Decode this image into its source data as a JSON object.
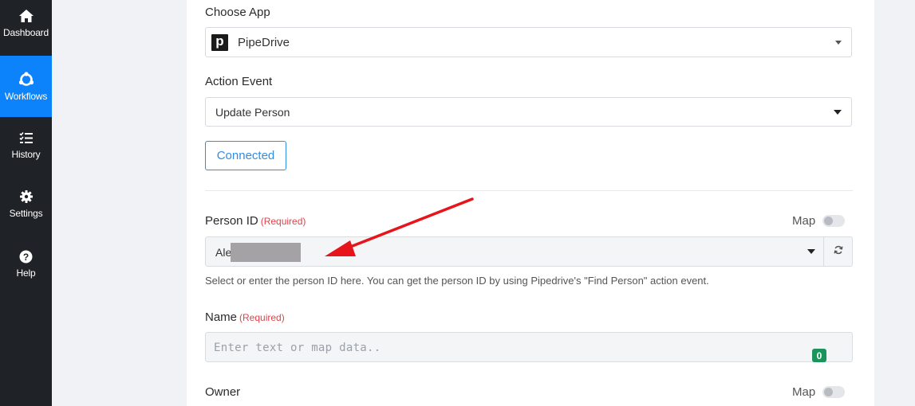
{
  "sidebar": {
    "items": [
      {
        "label": "Dashboard",
        "icon": "home-icon",
        "active": false
      },
      {
        "label": "Workflows",
        "icon": "workflows-icon",
        "active": true
      },
      {
        "label": "History",
        "icon": "history-list-icon",
        "active": false
      },
      {
        "label": "Settings",
        "icon": "gear-icon",
        "active": false
      },
      {
        "label": "Help",
        "icon": "help-icon",
        "active": false
      }
    ],
    "active_color": "#0d83fb",
    "background": "#1f2226"
  },
  "form": {
    "choose_app": {
      "label": "Choose App",
      "value": "PipeDrive",
      "logo_letter": "p"
    },
    "action_event": {
      "label": "Action Event",
      "value": "Update Person"
    },
    "connected_button": "Connected",
    "person_id": {
      "label": "Person ID",
      "required": "(Required)",
      "map_label": "Map",
      "value": "Ale",
      "help": "Select or enter the person ID here. You can get the person ID by using Pipedrive's \"Find Person\" action event."
    },
    "name": {
      "label": "Name",
      "required": "(Required)",
      "placeholder": "Enter text or map data..",
      "counter": "0"
    },
    "owner": {
      "label": "Owner",
      "map_label": "Map"
    }
  },
  "colors": {
    "accent": "#2e8ee8",
    "required": "#e0424b",
    "badge": "#19955c",
    "arrow": "#e8141c"
  }
}
